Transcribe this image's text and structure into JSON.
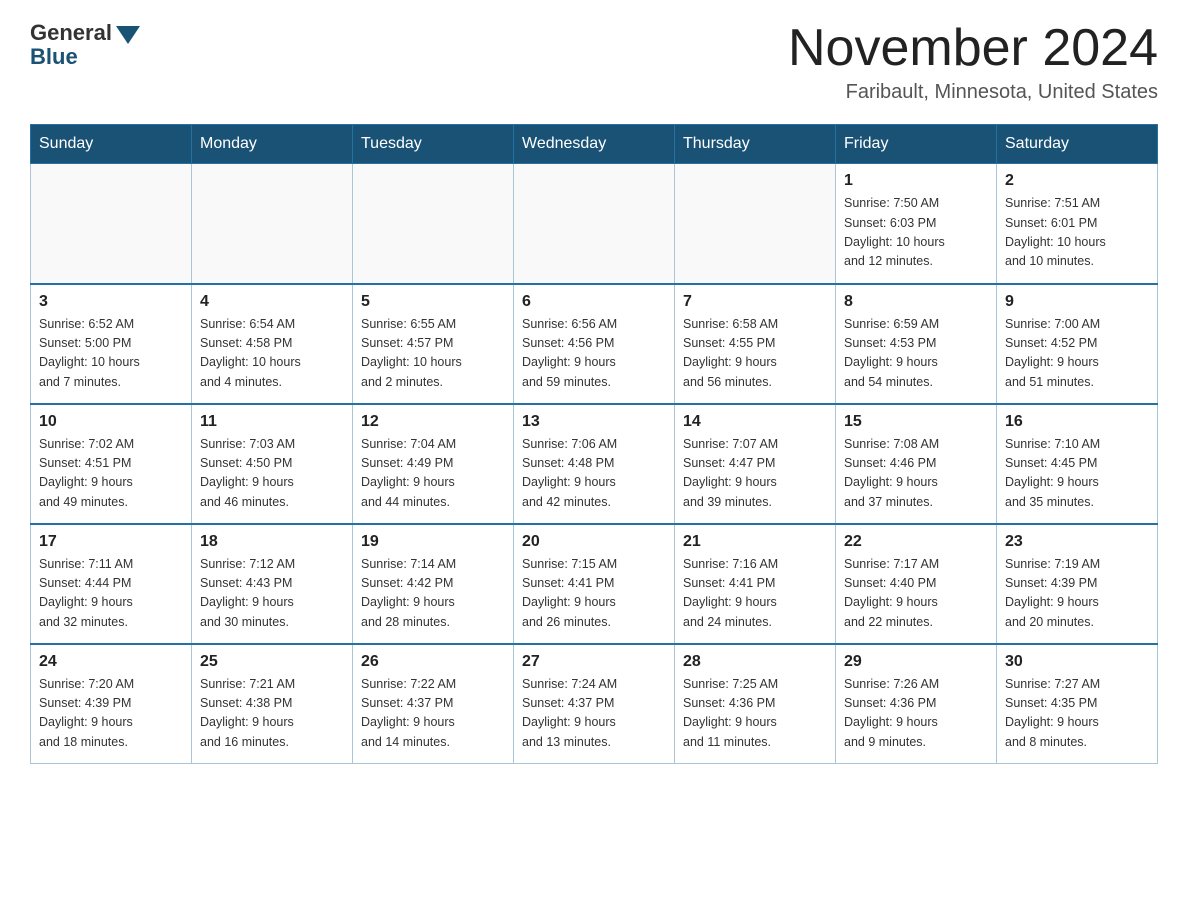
{
  "header": {
    "logo_general": "General",
    "logo_blue": "Blue",
    "month_title": "November 2024",
    "location": "Faribault, Minnesota, United States"
  },
  "days_of_week": [
    "Sunday",
    "Monday",
    "Tuesday",
    "Wednesday",
    "Thursday",
    "Friday",
    "Saturday"
  ],
  "weeks": [
    [
      {
        "day": "",
        "info": ""
      },
      {
        "day": "",
        "info": ""
      },
      {
        "day": "",
        "info": ""
      },
      {
        "day": "",
        "info": ""
      },
      {
        "day": "",
        "info": ""
      },
      {
        "day": "1",
        "info": "Sunrise: 7:50 AM\nSunset: 6:03 PM\nDaylight: 10 hours\nand 12 minutes."
      },
      {
        "day": "2",
        "info": "Sunrise: 7:51 AM\nSunset: 6:01 PM\nDaylight: 10 hours\nand 10 minutes."
      }
    ],
    [
      {
        "day": "3",
        "info": "Sunrise: 6:52 AM\nSunset: 5:00 PM\nDaylight: 10 hours\nand 7 minutes."
      },
      {
        "day": "4",
        "info": "Sunrise: 6:54 AM\nSunset: 4:58 PM\nDaylight: 10 hours\nand 4 minutes."
      },
      {
        "day": "5",
        "info": "Sunrise: 6:55 AM\nSunset: 4:57 PM\nDaylight: 10 hours\nand 2 minutes."
      },
      {
        "day": "6",
        "info": "Sunrise: 6:56 AM\nSunset: 4:56 PM\nDaylight: 9 hours\nand 59 minutes."
      },
      {
        "day": "7",
        "info": "Sunrise: 6:58 AM\nSunset: 4:55 PM\nDaylight: 9 hours\nand 56 minutes."
      },
      {
        "day": "8",
        "info": "Sunrise: 6:59 AM\nSunset: 4:53 PM\nDaylight: 9 hours\nand 54 minutes."
      },
      {
        "day": "9",
        "info": "Sunrise: 7:00 AM\nSunset: 4:52 PM\nDaylight: 9 hours\nand 51 minutes."
      }
    ],
    [
      {
        "day": "10",
        "info": "Sunrise: 7:02 AM\nSunset: 4:51 PM\nDaylight: 9 hours\nand 49 minutes."
      },
      {
        "day": "11",
        "info": "Sunrise: 7:03 AM\nSunset: 4:50 PM\nDaylight: 9 hours\nand 46 minutes."
      },
      {
        "day": "12",
        "info": "Sunrise: 7:04 AM\nSunset: 4:49 PM\nDaylight: 9 hours\nand 44 minutes."
      },
      {
        "day": "13",
        "info": "Sunrise: 7:06 AM\nSunset: 4:48 PM\nDaylight: 9 hours\nand 42 minutes."
      },
      {
        "day": "14",
        "info": "Sunrise: 7:07 AM\nSunset: 4:47 PM\nDaylight: 9 hours\nand 39 minutes."
      },
      {
        "day": "15",
        "info": "Sunrise: 7:08 AM\nSunset: 4:46 PM\nDaylight: 9 hours\nand 37 minutes."
      },
      {
        "day": "16",
        "info": "Sunrise: 7:10 AM\nSunset: 4:45 PM\nDaylight: 9 hours\nand 35 minutes."
      }
    ],
    [
      {
        "day": "17",
        "info": "Sunrise: 7:11 AM\nSunset: 4:44 PM\nDaylight: 9 hours\nand 32 minutes."
      },
      {
        "day": "18",
        "info": "Sunrise: 7:12 AM\nSunset: 4:43 PM\nDaylight: 9 hours\nand 30 minutes."
      },
      {
        "day": "19",
        "info": "Sunrise: 7:14 AM\nSunset: 4:42 PM\nDaylight: 9 hours\nand 28 minutes."
      },
      {
        "day": "20",
        "info": "Sunrise: 7:15 AM\nSunset: 4:41 PM\nDaylight: 9 hours\nand 26 minutes."
      },
      {
        "day": "21",
        "info": "Sunrise: 7:16 AM\nSunset: 4:41 PM\nDaylight: 9 hours\nand 24 minutes."
      },
      {
        "day": "22",
        "info": "Sunrise: 7:17 AM\nSunset: 4:40 PM\nDaylight: 9 hours\nand 22 minutes."
      },
      {
        "day": "23",
        "info": "Sunrise: 7:19 AM\nSunset: 4:39 PM\nDaylight: 9 hours\nand 20 minutes."
      }
    ],
    [
      {
        "day": "24",
        "info": "Sunrise: 7:20 AM\nSunset: 4:39 PM\nDaylight: 9 hours\nand 18 minutes."
      },
      {
        "day": "25",
        "info": "Sunrise: 7:21 AM\nSunset: 4:38 PM\nDaylight: 9 hours\nand 16 minutes."
      },
      {
        "day": "26",
        "info": "Sunrise: 7:22 AM\nSunset: 4:37 PM\nDaylight: 9 hours\nand 14 minutes."
      },
      {
        "day": "27",
        "info": "Sunrise: 7:24 AM\nSunset: 4:37 PM\nDaylight: 9 hours\nand 13 minutes."
      },
      {
        "day": "28",
        "info": "Sunrise: 7:25 AM\nSunset: 4:36 PM\nDaylight: 9 hours\nand 11 minutes."
      },
      {
        "day": "29",
        "info": "Sunrise: 7:26 AM\nSunset: 4:36 PM\nDaylight: 9 hours\nand 9 minutes."
      },
      {
        "day": "30",
        "info": "Sunrise: 7:27 AM\nSunset: 4:35 PM\nDaylight: 9 hours\nand 8 minutes."
      }
    ]
  ]
}
